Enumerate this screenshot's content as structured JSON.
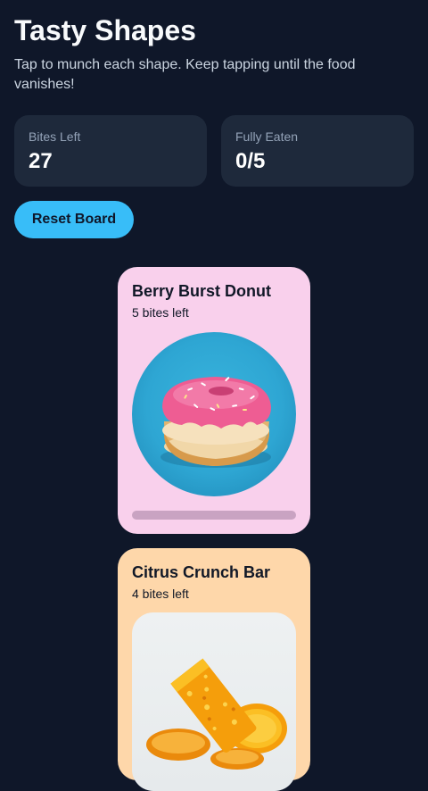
{
  "header": {
    "title": "Tasty Shapes",
    "subtitle": "Tap to munch each shape. Keep tapping until the food vanishes!"
  },
  "stats": {
    "bites_left_label": "Bites Left",
    "bites_left_value": "27",
    "fully_eaten_label": "Fully Eaten",
    "fully_eaten_value": "0/5"
  },
  "controls": {
    "reset_label": "Reset Board"
  },
  "cards": [
    {
      "name": "Berry Burst Donut",
      "bites": "5 bites left",
      "eaten_fraction": 0,
      "color": "#f9d0ec",
      "shape": "circle",
      "image": "donut-icon"
    },
    {
      "name": "Citrus Crunch Bar",
      "bites": "4 bites left",
      "color": "#fed7aa",
      "shape": "rounded-rect",
      "image": "citrus-bar-icon"
    }
  ],
  "colors": {
    "background": "#0f1729",
    "accent": "#38bdf8",
    "stat_card": "#1e293b"
  }
}
